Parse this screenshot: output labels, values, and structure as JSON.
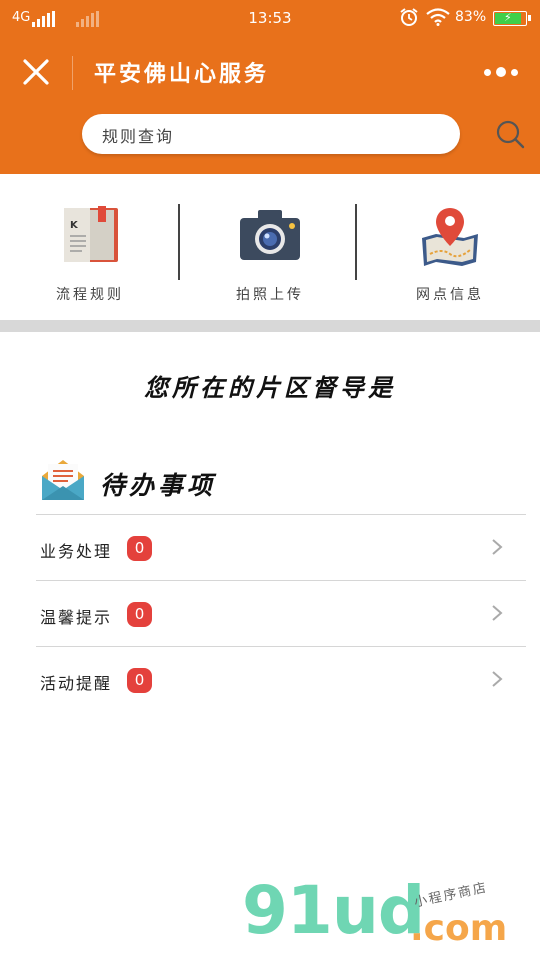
{
  "status_bar": {
    "network": "4G",
    "time": "13:53",
    "battery_percent": "83%",
    "icons": [
      "signal-icon",
      "alarm-icon",
      "wifi-icon",
      "battery-icon"
    ]
  },
  "header": {
    "title": "平安佛山心服务",
    "close_icon": "close-icon",
    "more_icon": "more-icon",
    "background_color": "#E8711B"
  },
  "search": {
    "placeholder": "规则查询",
    "icon": "search-icon"
  },
  "quick_actions": [
    {
      "label": "流程规则",
      "icon": "book-icon"
    },
    {
      "label": "拍照上传",
      "icon": "camera-icon"
    },
    {
      "label": "网点信息",
      "icon": "map-pin-icon"
    }
  ],
  "district_heading": "您所在的片区督导是",
  "todo": {
    "title": "待办事项",
    "icon": "envelope-icon",
    "items": [
      {
        "label": "业务处理",
        "count": "0"
      },
      {
        "label": "温馨提示",
        "count": "0"
      },
      {
        "label": "活动提醒",
        "count": "0"
      }
    ],
    "badge_color": "#e4413c"
  },
  "watermark": {
    "brand": "91ud",
    "suffix": ".com",
    "tagline": "小程序商店"
  }
}
